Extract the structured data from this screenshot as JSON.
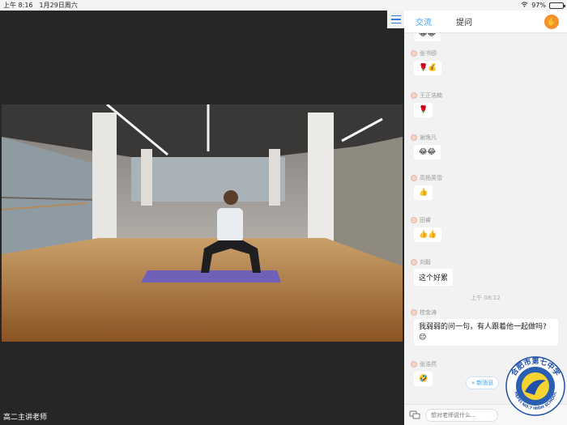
{
  "statusbar": {
    "time": "上午 8:16",
    "date": "1月29日周六",
    "battery": "97%",
    "battery_level": 0.97
  },
  "video": {
    "presenter_label": "高二主讲老师"
  },
  "chat": {
    "tabs": [
      {
        "label": "交流"
      },
      {
        "label": "提问"
      }
    ],
    "messages": [
      {
        "name": "张书颐",
        "text": "🌹💰"
      },
      {
        "name": "王正浩楠",
        "text": "🌹"
      },
      {
        "name": "谢逸凡",
        "text": "😂😂"
      },
      {
        "name": "高杨英雪",
        "text": "👍"
      },
      {
        "name": "田睿",
        "text": "👍👍"
      },
      {
        "name": "刘毅",
        "text": "这个好累"
      },
      {
        "name": "桂金涛",
        "text": "我弱弱的问一句，有人跟着他一起做吗? 😌"
      },
      {
        "name": "张浩然",
        "text": "🤣"
      }
    ],
    "timestamp": "上午 08:12",
    "new_message_pill": "新消息",
    "input_placeholder": "想对老师说什么..."
  },
  "logo": {
    "text_top": "合肥市第七中学",
    "text_bottom": "HEFEI NO.7 HIGH SCHOOL"
  },
  "colors": {
    "accent": "#3b9ff0",
    "hand": "#f5902a",
    "logo_blue": "#1f4fa8"
  }
}
